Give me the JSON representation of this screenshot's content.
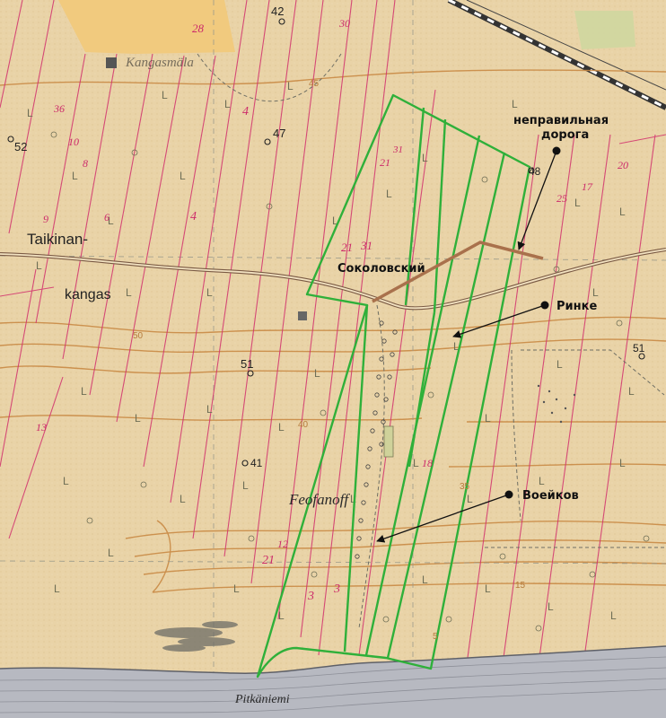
{
  "annotations": {
    "wrong_road": [
      "неправильная",
      "дорога"
    ],
    "sokolovsky": "Соколовский",
    "rinke": "Ринке",
    "voeikov": "Воейков"
  },
  "place_names": {
    "taikinan": "Taikinan-",
    "kangas": "kangas",
    "kangasmala": "Kangasmäla",
    "feofanoff": "Feofanoff",
    "pitkaniemi": "Pitkäniemi"
  },
  "point_labels": {
    "p42": "42",
    "p47": "47",
    "p48": "48",
    "p52": "52",
    "p51_center": "51",
    "p51_east": "51",
    "p41": "41"
  },
  "contour_labels": {
    "c50": "50",
    "c45": "45",
    "c40": "40",
    "c35": "35",
    "c15": "15",
    "c5": "5"
  },
  "parcel_numbers": {
    "n28": "28",
    "n21a": "21",
    "n31a": "31",
    "n21b": "21",
    "n31b": "31",
    "n4a": "4",
    "n4b": "4",
    "n3a": "3",
    "n3b": "3",
    "n21c": "21",
    "n12": "12",
    "n10": "10",
    "n20": "20",
    "n17": "17",
    "n18": "18",
    "n13": "13",
    "n8": "8",
    "n9": "9",
    "n6": "6",
    "n30": "30",
    "n36": "36",
    "n25": "25"
  },
  "colors": {
    "paper": "#e9d3a7",
    "boundary": "#2fb03a",
    "parcel_line": "#d2326e",
    "road": "#a0674a",
    "wrong_road": "#b07a52",
    "contour": "#c98a45",
    "sea": "#b7b9c1"
  }
}
